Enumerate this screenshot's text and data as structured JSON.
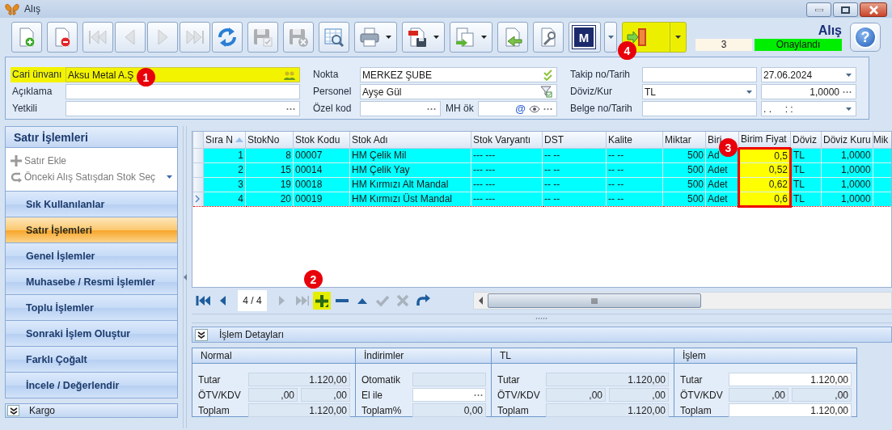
{
  "window": {
    "title": "Alış"
  },
  "toolbar": {
    "buttons": [
      {
        "kind": "new",
        "disabled": false,
        "dropdown": false,
        "highlighted": false
      },
      {
        "kind": "delete",
        "disabled": false,
        "dropdown": false,
        "highlighted": false
      },
      {
        "kind": "first",
        "disabled": true,
        "dropdown": false,
        "highlighted": false
      },
      {
        "kind": "prev",
        "disabled": true,
        "dropdown": false,
        "highlighted": false
      },
      {
        "kind": "next",
        "disabled": true,
        "dropdown": false,
        "highlighted": false
      },
      {
        "kind": "last",
        "disabled": true,
        "dropdown": false,
        "highlighted": false
      },
      {
        "kind": "refresh",
        "disabled": false,
        "dropdown": false,
        "highlighted": false
      },
      {
        "kind": "save",
        "disabled": true,
        "dropdown": false,
        "highlighted": false
      },
      {
        "kind": "cancel",
        "disabled": true,
        "dropdown": false,
        "highlighted": false
      },
      {
        "kind": "preview",
        "disabled": false,
        "dropdown": false,
        "highlighted": false
      },
      {
        "kind": "print",
        "disabled": false,
        "dropdown": true,
        "highlighted": false
      },
      {
        "kind": "pdf",
        "disabled": false,
        "dropdown": true,
        "highlighted": false
      },
      {
        "kind": "export",
        "disabled": false,
        "dropdown": true,
        "highlighted": false
      },
      {
        "kind": "import",
        "disabled": false,
        "dropdown": false,
        "highlighted": false
      },
      {
        "kind": "settings",
        "disabled": false,
        "dropdown": false,
        "highlighted": false
      },
      {
        "kind": "m",
        "label": "M",
        "disabled": false,
        "dropdown": true,
        "highlighted": false
      },
      {
        "kind": "exit",
        "disabled": false,
        "dropdown": true,
        "highlighted": true,
        "badge": "4"
      }
    ],
    "doc_title": "Alış",
    "doc_number": "3",
    "status": "Onaylandı",
    "help": "?"
  },
  "header": {
    "fields": [
      {
        "label": "Cari ünvanı",
        "value": "Aksu Metal A.Ş",
        "kind": "lookup",
        "highlighted": true,
        "badge": "1"
      },
      {
        "label": "Açıklama",
        "kind": "text",
        "highlighted": false
      },
      {
        "label": "Yetkili",
        "kind": "ellipsis",
        "highlighted": false
      },
      {
        "label": "Nokta",
        "value": "MERKEZ ŞUBE",
        "kind": "check",
        "highlighted": false
      },
      {
        "label": "Personel",
        "value": "Ayşe Gül",
        "kind": "filter",
        "highlighted": false
      },
      {
        "label": "Özel kod",
        "kind": "ellipsis",
        "highlighted": false,
        "extra": {
          "label": "MH ök",
          "symbol": "@"
        }
      },
      {
        "label": "Takip no/Tarih",
        "kind": "text",
        "highlighted": false,
        "second": {
          "value": "27.06.2024",
          "kind": "combo"
        }
      },
      {
        "label": "Döviz/Kur",
        "value": "TL",
        "kind": "combo",
        "highlighted": false,
        "second": {
          "value": "1,0000",
          "kind": "number"
        }
      },
      {
        "label": "Belge no/Tarih",
        "kind": "text",
        "highlighted": false,
        "second": {
          "value": ". .     : :",
          "kind": "combo"
        }
      }
    ]
  },
  "side_panel": {
    "title": "Satır İşlemleri",
    "actions": [
      {
        "label": "Satır Ekle",
        "kind": "add",
        "disabled": true,
        "dropdown": false
      },
      {
        "label": "Önceki Alış Satışdan Stok Seç",
        "kind": "history",
        "disabled": true,
        "dropdown": true
      }
    ],
    "items": [
      {
        "label": "Sık Kullanılanlar",
        "selected": false
      },
      {
        "label": "Satır İşlemleri",
        "selected": true
      },
      {
        "label": "Genel İşlemler",
        "selected": false
      },
      {
        "label": "Muhasebe / Resmi İşlemler",
        "selected": false
      },
      {
        "label": "Toplu İşlemler",
        "selected": false
      },
      {
        "label": "Sonraki İşlem Oluştur",
        "selected": false
      },
      {
        "label": "Farklı Çoğalt",
        "selected": false
      },
      {
        "label": "İncele / Değerlendir",
        "selected": false
      }
    ],
    "footer": "Kargo"
  },
  "grid": {
    "columns": [
      {
        "label": "Sıra N",
        "sorted": true,
        "highlighted": false
      },
      {
        "label": "StokNo",
        "sorted": false,
        "highlighted": false
      },
      {
        "label": "Stok Kodu",
        "sorted": false,
        "highlighted": false
      },
      {
        "label": "Stok Adı",
        "sorted": false,
        "highlighted": false
      },
      {
        "label": "Stok Varyantı",
        "sorted": false,
        "highlighted": false
      },
      {
        "label": "DST",
        "sorted": false,
        "highlighted": false
      },
      {
        "label": "Kalite",
        "sorted": false,
        "highlighted": false
      },
      {
        "label": "Miktar",
        "sorted": false,
        "highlighted": false
      },
      {
        "label": "Biri",
        "sorted": false,
        "highlighted": false
      },
      {
        "label": "Birim Fiyat",
        "sorted": false,
        "highlighted": true,
        "badge": "3"
      },
      {
        "label": "Döviz",
        "sorted": false,
        "highlighted": false
      },
      {
        "label": "Döviz Kuru",
        "sorted": false,
        "highlighted": false
      },
      {
        "label": "Mik",
        "sorted": false,
        "highlighted": false
      }
    ],
    "rows": [
      {
        "selected": false,
        "cells": [
          "1",
          "8",
          "00007",
          "HM Çelik Mil",
          "--- ---",
          "-- --",
          "-- --",
          "500",
          "Ad",
          "0,5",
          "TL",
          "1,0000"
        ]
      },
      {
        "selected": false,
        "cells": [
          "2",
          "15",
          "00014",
          "HM Çelik Yay",
          "--- ---",
          "-- --",
          "-- --",
          "500",
          "Adet",
          "0,52",
          "TL",
          "1,0000"
        ]
      },
      {
        "selected": false,
        "cells": [
          "3",
          "19",
          "00018",
          "HM Kırmızı Alt Mandal",
          "--- ---",
          "-- --",
          "-- --",
          "500",
          "Adet",
          "0,62",
          "TL",
          "1,0000"
        ]
      },
      {
        "selected": true,
        "cells": [
          "4",
          "20",
          "00019",
          "HM Kırmızı Üst Mandal",
          "--- ---",
          "-- --",
          "-- --",
          "500",
          "Adet",
          "0,6",
          "TL",
          "1,0000"
        ]
      }
    ]
  },
  "navigator": {
    "before": [
      {
        "kind": "first",
        "disabled": false,
        "highlighted": false
      },
      {
        "kind": "prev",
        "disabled": false,
        "highlighted": false
      }
    ],
    "position": "4 / 4",
    "after": [
      {
        "kind": "next",
        "disabled": true,
        "highlighted": false
      },
      {
        "kind": "last",
        "disabled": true,
        "highlighted": false
      },
      {
        "kind": "add",
        "disabled": false,
        "highlighted": true,
        "badge": "2"
      },
      {
        "kind": "remove",
        "disabled": false,
        "highlighted": false
      },
      {
        "kind": "up",
        "disabled": false,
        "highlighted": false
      },
      {
        "kind": "confirm",
        "disabled": true,
        "highlighted": false
      },
      {
        "kind": "cancel",
        "disabled": true,
        "highlighted": false
      },
      {
        "kind": "redo",
        "disabled": false,
        "highlighted": false
      }
    ]
  },
  "details": {
    "title": "İşlem Detayları",
    "groups": [
      {
        "title": "Normal",
        "rows": [
          {
            "label": "Tutar",
            "fields": [
              {
                "value": "1.120,00",
                "editable": false,
                "kind": "plain"
              }
            ]
          },
          {
            "label": "ÖTV/KDV",
            "fields": [
              {
                "value": ",00",
                "editable": false,
                "kind": "plain"
              },
              {
                "value": ",00",
                "editable": false,
                "kind": "plain"
              }
            ]
          },
          {
            "label": "Toplam",
            "fields": [
              {
                "value": "1.120,00",
                "editable": false,
                "kind": "plain"
              }
            ]
          }
        ]
      },
      {
        "title": "İndirimler",
        "rows": [
          {
            "label": "Otomatik",
            "fields": [
              {
                "editable": false,
                "kind": "plain"
              }
            ]
          },
          {
            "label": "El ile",
            "fields": [
              {
                "editable": true,
                "kind": "ellipsis"
              }
            ]
          },
          {
            "label": "Toplam%",
            "fields": [
              {
                "value": "0,00",
                "editable": false,
                "kind": "plain"
              }
            ]
          }
        ]
      },
      {
        "title": "TL",
        "rows": [
          {
            "label": "Tutar",
            "fields": [
              {
                "value": "1.120,00",
                "editable": false,
                "kind": "plain"
              }
            ]
          },
          {
            "label": "ÖTV/KDV",
            "fields": [
              {
                "value": ",00",
                "editable": false,
                "kind": "plain"
              },
              {
                "value": ",00",
                "editable": false,
                "kind": "plain"
              }
            ]
          },
          {
            "label": "Toplam",
            "fields": [
              {
                "value": "1.120,00",
                "editable": false,
                "kind": "plain"
              }
            ]
          }
        ]
      },
      {
        "title": "İşlem",
        "rows": [
          {
            "label": "Tutar",
            "fields": [
              {
                "value": "1.120,00",
                "editable": true,
                "kind": "plain"
              }
            ]
          },
          {
            "label": "ÖTV/KDV",
            "fields": [
              {
                "value": ",00",
                "editable": false,
                "kind": "plain"
              },
              {
                "value": ",00",
                "editable": false,
                "kind": "plain"
              }
            ]
          },
          {
            "label": "Toplam",
            "fields": [
              {
                "value": "1.120,00",
                "editable": true,
                "kind": "plain"
              }
            ]
          }
        ]
      }
    ]
  }
}
